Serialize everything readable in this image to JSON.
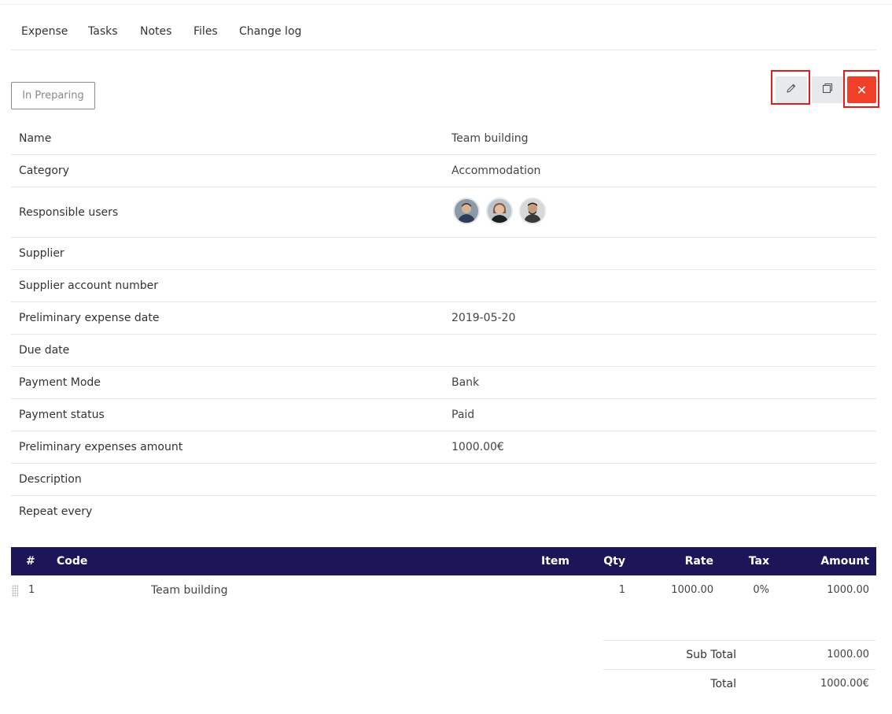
{
  "tabs": [
    "Expense",
    "Tasks",
    "Notes",
    "Files",
    "Change log"
  ],
  "status_button": "In Preparing",
  "actions": {
    "edit_icon": "pencil-icon",
    "copy_icon": "copy-icon",
    "delete_icon": "close-icon",
    "delete_glyph": "✕",
    "delete_color": "#f1402a",
    "highlight_color": "#e31b1b"
  },
  "details": {
    "name": {
      "label": "Name",
      "value": "Team building"
    },
    "category": {
      "label": "Category",
      "value": "Accommodation"
    },
    "responsible_users": {
      "label": "Responsible users"
    },
    "supplier": {
      "label": "Supplier",
      "value": ""
    },
    "supplier_account_number": {
      "label": "Supplier account number",
      "value": ""
    },
    "preliminary_expense_date": {
      "label": "Preliminary expense date",
      "value": "2019-05-20"
    },
    "due_date": {
      "label": "Due date",
      "value": ""
    },
    "payment_mode": {
      "label": "Payment Mode",
      "value": "Bank"
    },
    "payment_status": {
      "label": "Payment status",
      "value": "Paid"
    },
    "preliminary_expenses_amount": {
      "label": "Preliminary expenses amount",
      "value": "1000.00€"
    },
    "description": {
      "label": "Description",
      "value": ""
    },
    "repeat_every": {
      "label": "Repeat every",
      "value": ""
    }
  },
  "items_table": {
    "header_bg": "#1c1558",
    "headers": {
      "num": "#",
      "code": "Code",
      "item": "Item",
      "qty": "Qty",
      "rate": "Rate",
      "tax": "Tax",
      "amount": "Amount"
    },
    "rows": [
      {
        "num": "1",
        "code": "",
        "item": "Team building",
        "qty": "1",
        "rate": "1000.00",
        "tax": "0%",
        "amount": "1000.00"
      }
    ]
  },
  "totals": {
    "subtotal_label": "Sub Total",
    "subtotal_value": "1000.00",
    "total_label": "Total",
    "total_value": "1000.00€"
  }
}
